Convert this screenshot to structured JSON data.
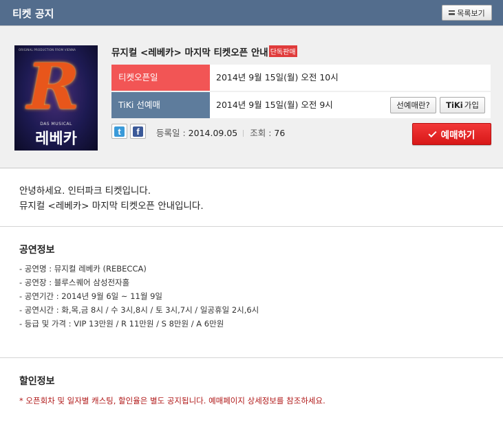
{
  "header": {
    "title": "티켓 공지",
    "list_button_label": "목록보기"
  },
  "poster": {
    "top_text": "ORIGINAL PRODUCTION FROM VIENNA",
    "big_letter": "R",
    "subtitle": "DAS MUSICAL",
    "korean_title": "레베카"
  },
  "show": {
    "title": "뮤지컬 <레베카> 마지막 티켓오픈 안내",
    "badge": "단독판매",
    "ticket_open_label": "티켓오픈일",
    "ticket_open_value": "2014년 9월 15일(월) 오전 10시",
    "tiki_label": "TiKi 선예매",
    "tiki_value": "2014년 9월 15일(월) 오전 9시",
    "presale_button": "선예매란?",
    "tiki_join_logo": "TiKi",
    "tiki_join_label": "가입",
    "reg_label": "등록일 :",
    "reg_date": "2014.09.05",
    "views_label": "조회 :",
    "views": "76",
    "book_button": "예매하기"
  },
  "social": {
    "twitter_glyph": "t",
    "facebook_glyph": "f"
  },
  "body": {
    "greeting_line1": "안녕하세요. 인터파크 티켓입니다.",
    "greeting_line2": "뮤지컬 <레베카> 마지막 티켓오픈 안내입니다.",
    "performance_title": "공연정보",
    "performance_items": [
      "- 공연명 : 뮤지컬 레베카 (REBECCA)",
      "- 공연장 : 블루스퀘어 삼성전자홀",
      "- 공연기간 : 2014년 9월 6일 ~ 11월 9일",
      "- 공연시간 : 화,목,금 8시 / 수 3시,8시 / 토 3시,7시 / 일공휴일 2시,6시",
      "- 등급 및 가격 : VIP 13만원 / R 11만원 / S 8만원 / A 6만원"
    ],
    "discount_title": "할인정보",
    "discount_notice": "* 오픈회차 및 일자별 캐스팅, 할인율은 별도 공지됩니다. 예매페이지 상세정보를 참조하세요."
  },
  "colors": {
    "header_bg": "#536d8d",
    "ticket_open_label_bg": "#f25555",
    "tiki_label_bg": "#5e7c9c",
    "book_button_bg": "#e02424",
    "notice_text": "#b01818"
  }
}
